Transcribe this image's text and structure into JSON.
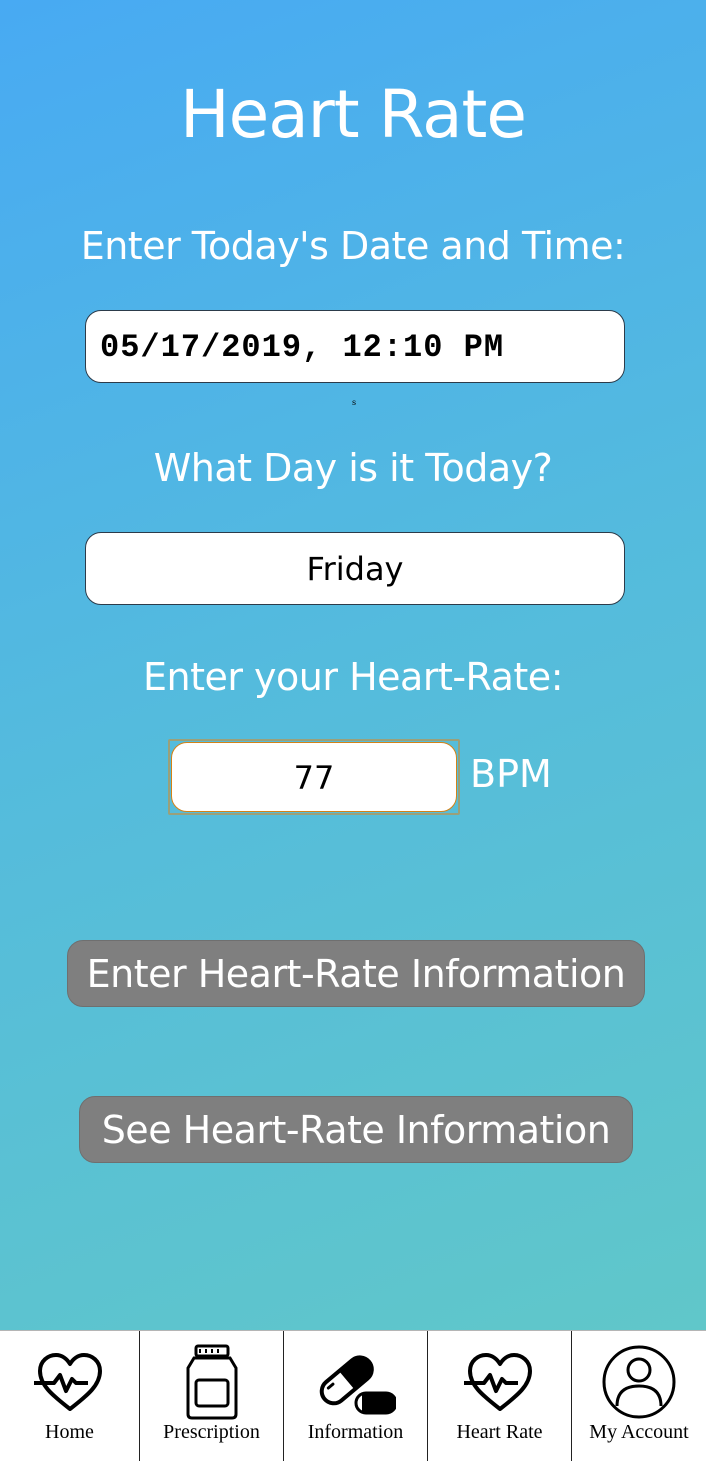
{
  "page": {
    "title": "Heart Rate"
  },
  "form": {
    "date_label": "Enter Today's Date and Time:",
    "date_value": "05/17/2019, 12:10 PM",
    "tiny_mark": "s",
    "day_label": "What Day is it Today?",
    "day_value": "Friday",
    "hr_label": "Enter your Heart-Rate:",
    "hr_value": "77",
    "hr_unit": "BPM"
  },
  "buttons": {
    "enter_label": "Enter Heart-Rate Information",
    "see_label": "See Heart-Rate Information"
  },
  "nav": {
    "items": [
      {
        "label": "Home",
        "icon": "heartbeat-icon"
      },
      {
        "label": "Prescription",
        "icon": "pill-bottle-icon"
      },
      {
        "label": "Information",
        "icon": "capsule-icon"
      },
      {
        "label": "Heart Rate",
        "icon": "heartbeat-icon"
      },
      {
        "label": "My Account",
        "icon": "user-circle-icon"
      }
    ]
  },
  "colors": {
    "gradient_start": "#48aaf3",
    "gradient_end": "#62c9c6",
    "button_bg": "#7f7f7f",
    "text_light": "#ffffff"
  }
}
